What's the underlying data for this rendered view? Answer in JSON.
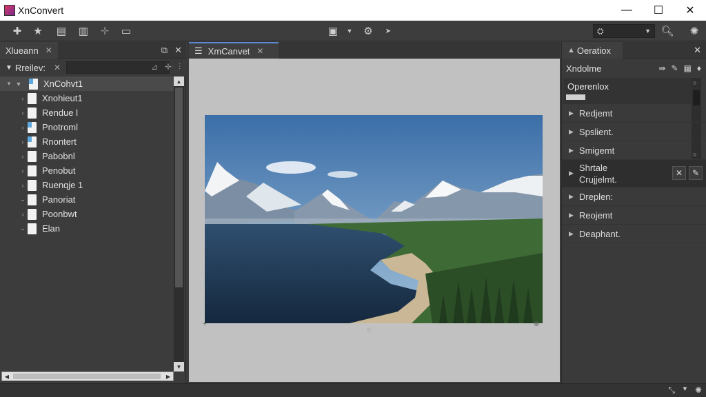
{
  "window": {
    "title": "XnConvert",
    "minimize": "—",
    "maximize": "☐",
    "close": "✕"
  },
  "toolbar": {
    "icons": [
      "add-icon",
      "star-icon",
      "stack-icon",
      "columns-icon",
      "arrow-icon",
      "monitor-icon",
      "view-icon",
      "settings-icon",
      "dropdown-icon",
      "zoom-icon",
      "options-icon"
    ],
    "combo_value": "⛭"
  },
  "left_panel": {
    "tab_label": "Xlueann",
    "filter_label": "Rreilev:",
    "tree": [
      {
        "label": "XnCohvt1",
        "expander": "▾",
        "icon": "blue",
        "selected": true
      },
      {
        "label": "Xnohieut1",
        "expander": "›",
        "icon": "plain"
      },
      {
        "label": "Rendue l",
        "expander": "›",
        "icon": "plain"
      },
      {
        "label": "Pnotroml",
        "expander": "›",
        "icon": "blue"
      },
      {
        "label": "Rnontert",
        "expander": "›",
        "icon": "blue"
      },
      {
        "label": "Pabobnl",
        "expander": "›",
        "icon": "plain"
      },
      {
        "label": "Penobut",
        "expander": "›",
        "icon": "plain"
      },
      {
        "label": "Ruenqje 1",
        "expander": "›",
        "icon": "plain"
      },
      {
        "label": "Panoriat",
        "expander": "⌄",
        "icon": "plain"
      },
      {
        "label": "Poonbwt",
        "expander": "›",
        "icon": "plain"
      },
      {
        "label": "Elan",
        "expander": "⌄",
        "icon": "plain"
      }
    ]
  },
  "center_panel": {
    "tab_label": "XmCanvet"
  },
  "right_panel": {
    "tab_label": "Oeratiox",
    "header": "Xndolme",
    "operation_box_label": "Operenlox",
    "operations": [
      {
        "label": "Redjemt"
      },
      {
        "label": "Spslient."
      },
      {
        "label": "Smigemt"
      },
      {
        "label": "Shrtale",
        "label2": "Crujjelmt.",
        "selected": true
      },
      {
        "label": "Dreplen:"
      },
      {
        "label": "Reojemt"
      },
      {
        "label": "Deaphant."
      }
    ]
  },
  "colors": {
    "accent": "#5a8ad0",
    "panel": "#3c3c3c",
    "canvas": "#c1c1c1"
  }
}
